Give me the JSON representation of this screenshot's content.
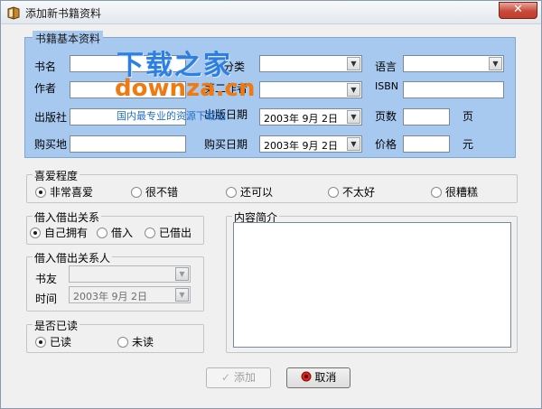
{
  "window": {
    "title": "添加新书籍资料",
    "close_symbol": "✕"
  },
  "basic_info": {
    "legend": "书籍基本资料",
    "name_label": "书名",
    "name_value": "",
    "category_label": "分类",
    "category_value": "",
    "language_label": "语言",
    "language_value": "",
    "author_label": "作者",
    "author_value": "",
    "second_author_label": "第二作者",
    "second_author_value": "",
    "isbn_label": "ISBN",
    "isbn_value": "",
    "publisher_label": "出版社",
    "publisher_value": "",
    "pub_date_label": "出版日期",
    "pub_date_value": "2003年 9月 2日",
    "pages_label": "页数",
    "pages_value": "",
    "pages_unit": "页",
    "buy_place_label": "购买地",
    "buy_place_value": "",
    "buy_date_label": "购买日期",
    "buy_date_value": "2003年 9月 2日",
    "price_label": "价格",
    "price_value": "",
    "price_unit": "元"
  },
  "preference": {
    "legend": "喜爱程度",
    "options": [
      "非常喜爱",
      "很不错",
      "还可以",
      "不太好",
      "很糟糕"
    ],
    "selected": 0
  },
  "lending": {
    "legend": "借入借出关系",
    "options": [
      "自己拥有",
      "借入",
      "已借出"
    ],
    "selected": 0
  },
  "lender": {
    "legend": "借入借出关系人",
    "friend_label": "书友",
    "friend_value": "",
    "time_label": "时间",
    "time_value": "2003年 9月 2日"
  },
  "read_status": {
    "legend": "是否已读",
    "options": [
      "已读",
      "未读"
    ],
    "selected": 0
  },
  "summary": {
    "legend": "内容简介",
    "value": ""
  },
  "buttons": {
    "add_label": "添加",
    "cancel_label": "取消"
  },
  "watermark": {
    "title": "下载之家",
    "domain": "downza.cn",
    "tagline": "国内最专业的资源下载站"
  },
  "colors": {
    "panel": "#a8c9ef",
    "watermark_blue": "#2d7fe0",
    "watermark_orange": "#f07a10"
  }
}
